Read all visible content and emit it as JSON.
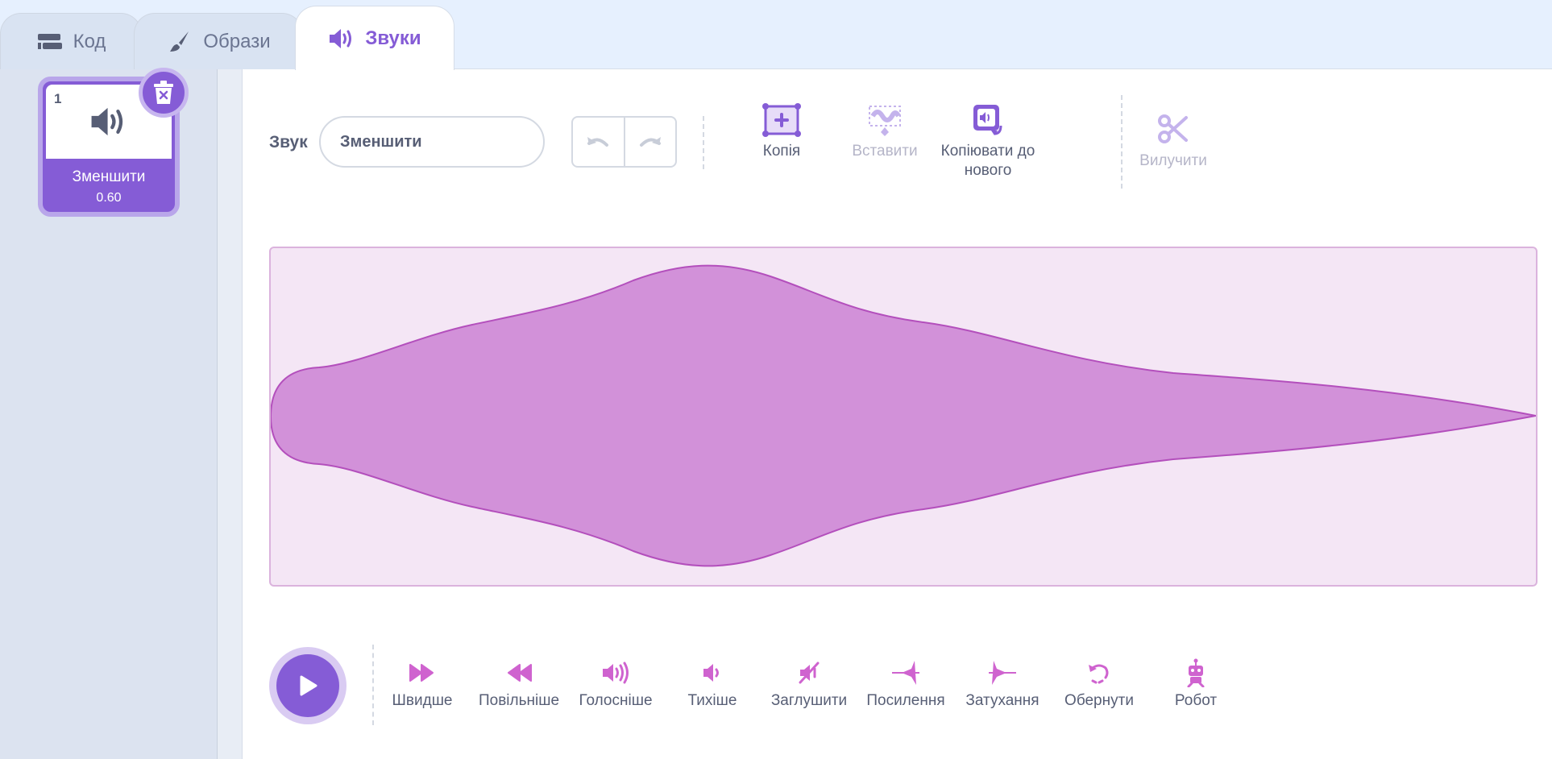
{
  "tabs": [
    {
      "label": "Код",
      "icon": "code-blocks-icon"
    },
    {
      "label": "Образи",
      "icon": "paintbrush-icon"
    },
    {
      "label": "Звуки",
      "icon": "speaker-icon"
    }
  ],
  "sound_list": {
    "items": [
      {
        "index": "1",
        "name": "Зменшити",
        "duration": "0.60",
        "icon": "speaker-icon"
      }
    ]
  },
  "editor": {
    "sound_label": "Звук",
    "sound_name": "Зменшити",
    "tools": {
      "copy": "Копія",
      "paste": "Вставити",
      "copy_to_new_line1": "Копіювати до",
      "copy_to_new_line2": "нового",
      "delete": "Вилучити"
    },
    "effects": [
      {
        "label": "Швидше",
        "icon": "faster-icon"
      },
      {
        "label": "Повільніше",
        "icon": "slower-icon"
      },
      {
        "label": "Голосніше",
        "icon": "louder-icon"
      },
      {
        "label": "Тихіше",
        "icon": "softer-icon"
      },
      {
        "label": "Заглушити",
        "icon": "mute-icon"
      },
      {
        "label": "Посилення",
        "icon": "fade-in-icon"
      },
      {
        "label": "Затухання",
        "icon": "fade-out-icon"
      },
      {
        "label": "Обернути",
        "icon": "reverse-icon"
      },
      {
        "label": "Робот",
        "icon": "robot-icon"
      }
    ]
  },
  "colors": {
    "accent": "#855cd6",
    "waveform_fill": "#d291d9",
    "waveform_stroke": "#b34fbc",
    "waveform_bg": "#f4e6f5",
    "effect_icon": "#cf63cf"
  }
}
